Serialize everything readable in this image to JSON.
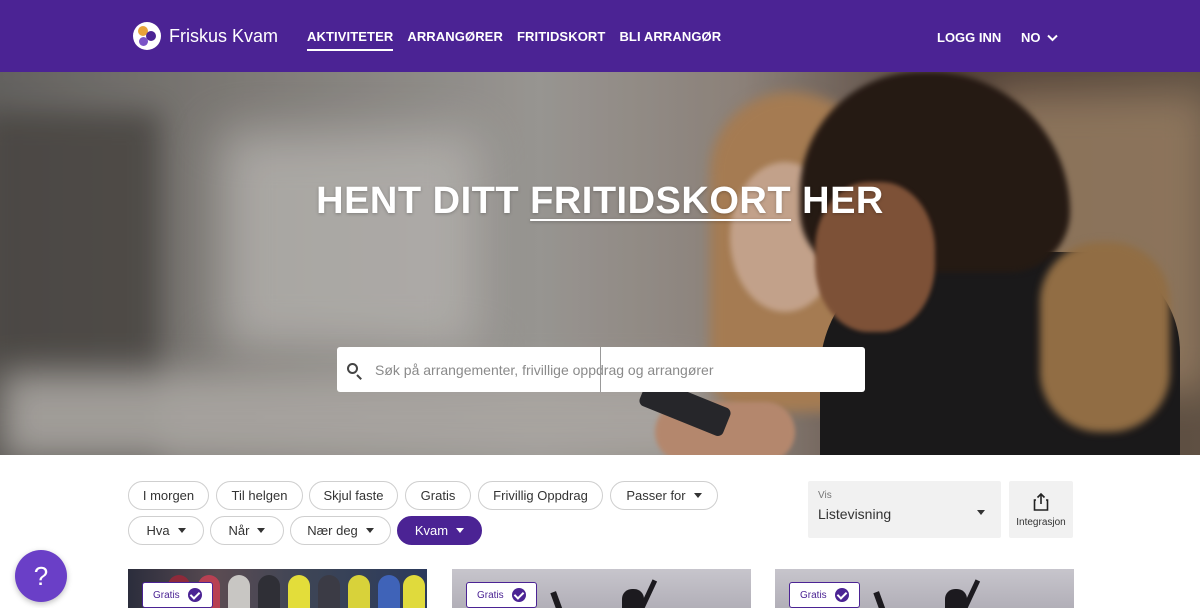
{
  "header": {
    "brand": "Friskus Kvam",
    "nav": [
      "AKTIVITETER",
      "ARRANGØRER",
      "FRITIDSKORT",
      "BLI ARRANGØR"
    ],
    "active_nav": "AKTIVITETER",
    "login": "LOGG INN",
    "language": "NO",
    "icons": {
      "logo": "friskus-logo",
      "language_caret": "chevron-down-icon"
    }
  },
  "hero": {
    "title_before": "HENT DITT",
    "title_highlight": "FRITIDSKORT",
    "title_after": "HER",
    "search_placeholder": "Søk på arrangementer, frivillige oppdrag og arrangører"
  },
  "filters": {
    "row1": [
      "I morgen",
      "Til helgen",
      "Skjul faste",
      "Gratis",
      "Frivillig Oppdrag",
      "Passer for"
    ],
    "row2": [
      "Hva",
      "Når",
      "Nær deg",
      "Kvam"
    ],
    "active": "Kvam"
  },
  "view": {
    "label": "Vis",
    "value": "Listevisning"
  },
  "integration": {
    "label": "Integrasjon"
  },
  "cards": [
    {
      "badge": "Gratis"
    },
    {
      "badge": "Gratis"
    },
    {
      "badge": "Gratis"
    }
  ],
  "help": {
    "label": "?"
  },
  "colors": {
    "brand_purple": "#4b2394",
    "help_purple": "#6a3fc7"
  }
}
